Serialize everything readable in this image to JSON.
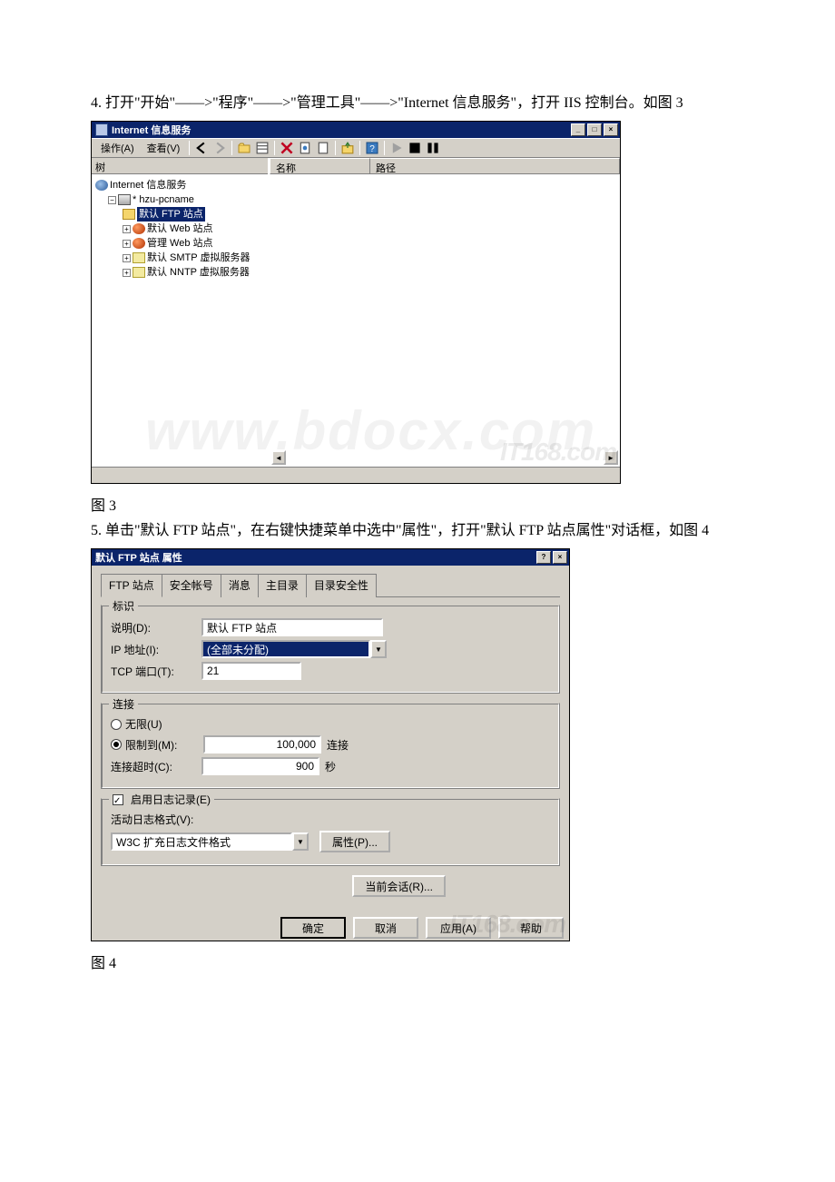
{
  "doc": {
    "p4": "4. 打开\"开始\"——>\"程序\"——>\"管理工具\"——>\"Internet 信息服务\"，打开 IIS 控制台。如图 3",
    "fig3": "图 3",
    "p5": "5. 单击\"默认 FTP 站点\"，在右键快捷菜单中选中\"属性\"，打开\"默认 FTP 站点属性\"对话框，如图 4",
    "fig4": "图 4"
  },
  "win1": {
    "title": "Internet 信息服务",
    "minimize": "_",
    "maximize": "□",
    "close": "×",
    "menu": {
      "action": "操作(A)",
      "view": "查看(V)"
    },
    "toolbar": {
      "back": "arrow-left-icon",
      "fwd": "arrow-right-icon",
      "up": "folder-up-icon",
      "show": "list-icon",
      "delete": "delete-icon",
      "props": "properties-icon",
      "refresh": "refresh-icon",
      "export": "export-icon",
      "help": "help-icon",
      "play": "play-icon",
      "stop": "stop-icon",
      "pause": "pause-icon"
    },
    "treeHeader": "树",
    "cols": {
      "name": "名称",
      "path": "路径"
    },
    "tree": {
      "root": "Internet 信息服务",
      "host": "* hzu-pcname",
      "ftp": "默认 FTP 站点",
      "web": "默认 Web 站点",
      "admin": "管理 Web 站点",
      "smtp": "默认 SMTP 虚拟服务器",
      "nntp": "默认 NNTP 虚拟服务器"
    },
    "watermark": "IT168.com"
  },
  "dlg": {
    "title": "默认 FTP 站点 属性",
    "help": "?",
    "close": "×",
    "tabs": {
      "site": "FTP 站点",
      "security": "安全帐号",
      "messages": "消息",
      "home": "主目录",
      "dirsec": "目录安全性"
    },
    "ident": {
      "legend": "标识",
      "descLabel": "说明(D):",
      "descValue": "默认 FTP 站点",
      "ipLabel": "IP 地址(I):",
      "ipValue": "(全部未分配)",
      "portLabel": "TCP 端口(T):",
      "portValue": "21"
    },
    "conn": {
      "legend": "连接",
      "unlimited": "无限(U)",
      "limitedTo": "限制到(M):",
      "limitValue": "100,000",
      "limitUnit": "连接",
      "timeoutLabel": "连接超时(C):",
      "timeoutValue": "900",
      "timeoutUnit": "秒"
    },
    "log": {
      "enable": "启用日志记录(E)",
      "formatLabel": "活动日志格式(V):",
      "formatValue": "W3C 扩充日志文件格式",
      "propsBtn": "属性(P)..."
    },
    "sessionsBtn": "当前会话(R)...",
    "buttons": {
      "ok": "确定",
      "cancel": "取消",
      "apply": "应用(A)",
      "help": "帮助"
    },
    "watermark": "IT168.com"
  },
  "pageWatermark": "www.bdocx.com"
}
